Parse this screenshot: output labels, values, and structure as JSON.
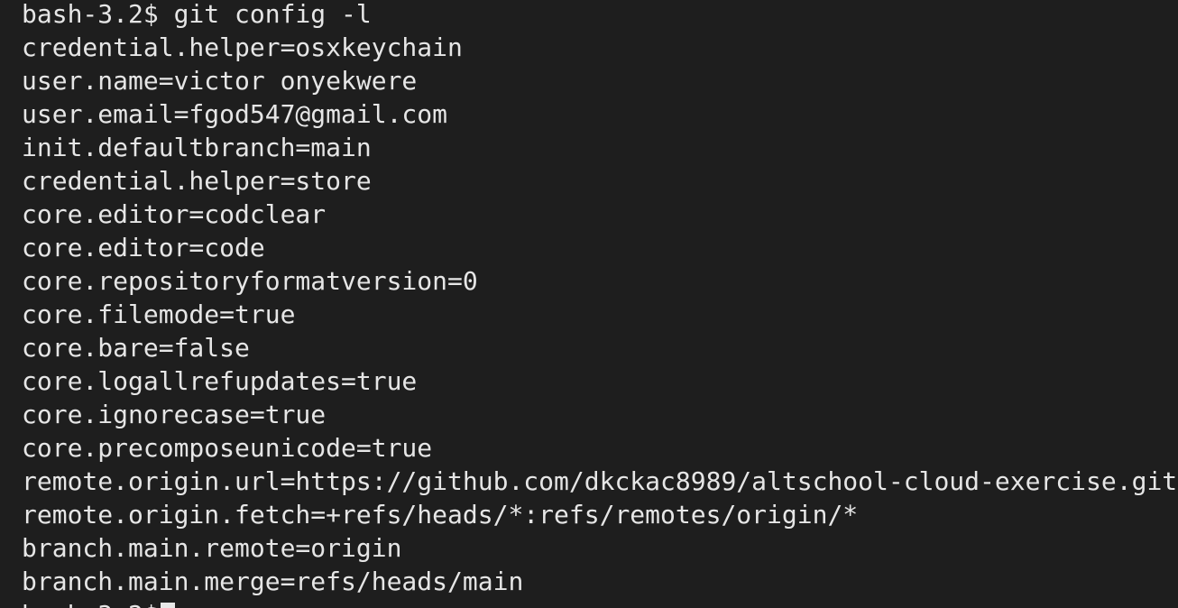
{
  "terminal": {
    "background": "#1e1e1e",
    "foreground": "#e6e6e6",
    "command_line": "bash-3.2$ git config -l",
    "output_lines": [
      "credential.helper=osxkeychain",
      "user.name=victor onyekwere",
      "user.email=fgod547@gmail.com",
      "init.defaultbranch=main",
      "credential.helper=store",
      "core.editor=codclear",
      "core.editor=code",
      "core.repositoryformatversion=0",
      "core.filemode=true",
      "core.bare=false",
      "core.logallrefupdates=true",
      "core.ignorecase=true",
      "core.precomposeunicode=true",
      "remote.origin.url=https://github.com/dkckac8989/altschool-cloud-exercise.git",
      "remote.origin.fetch=+refs/heads/*:refs/remotes/origin/*",
      "branch.main.remote=origin",
      "branch.main.merge=refs/heads/main"
    ],
    "prompt": "bash-3.2$"
  }
}
